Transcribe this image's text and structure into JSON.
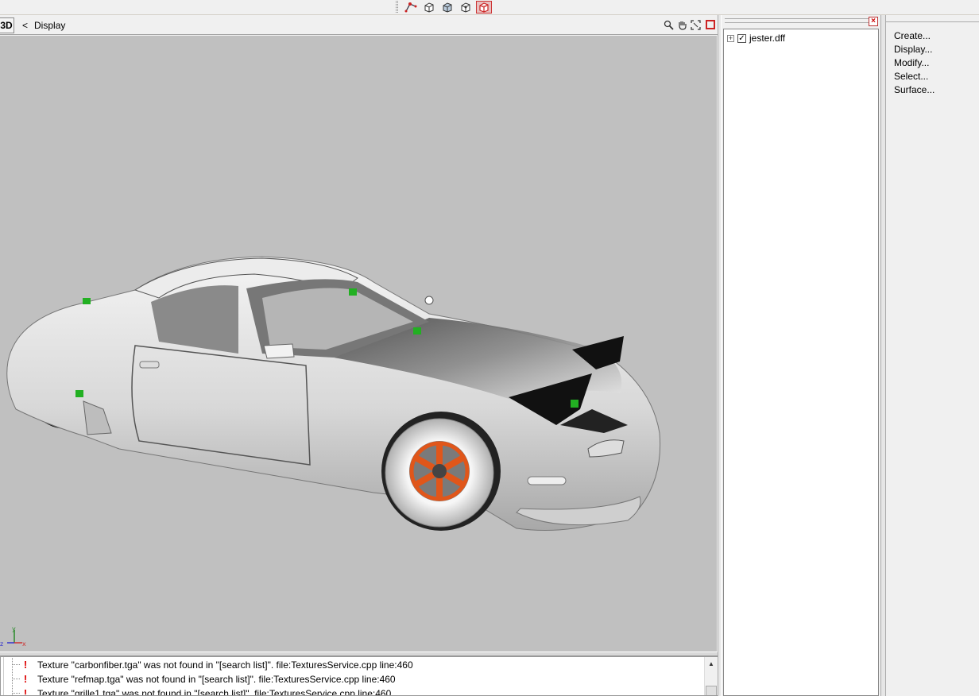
{
  "toolbar": {
    "buttons": [
      "vertex-tool-icon",
      "cube-icon",
      "cube-faces-icon",
      "cube-edges-icon",
      "cube-selected-icon"
    ]
  },
  "viewport": {
    "mode_label": "3D",
    "back_label": "<",
    "title": "Display",
    "axis_labels": {
      "x": "x",
      "y": "y",
      "z": "z"
    }
  },
  "log": {
    "lines": [
      "Texture \"carbonfiber.tga\" was not found in \"[search list]\". file:TexturesService.cpp line:460",
      "Texture \"refmap.tga\" was not found in \"[search list]\". file:TexturesService.cpp line:460",
      "Texture \"grille1.tga\" was not found in \"[search list]\". file:TexturesService.cpp line:460"
    ]
  },
  "scene": {
    "items": [
      {
        "label": "jester.dff",
        "checked": true
      }
    ]
  },
  "commands": {
    "items": [
      "Create...",
      "Display...",
      "Modify...",
      "Select...",
      "Surface..."
    ]
  },
  "colors": {
    "viewport_bg": "#c0c0c0",
    "car_body": "#e6e6e6",
    "wheel_accent": "#e0561a",
    "marker": "#22b022",
    "warning": "#dd0000"
  }
}
